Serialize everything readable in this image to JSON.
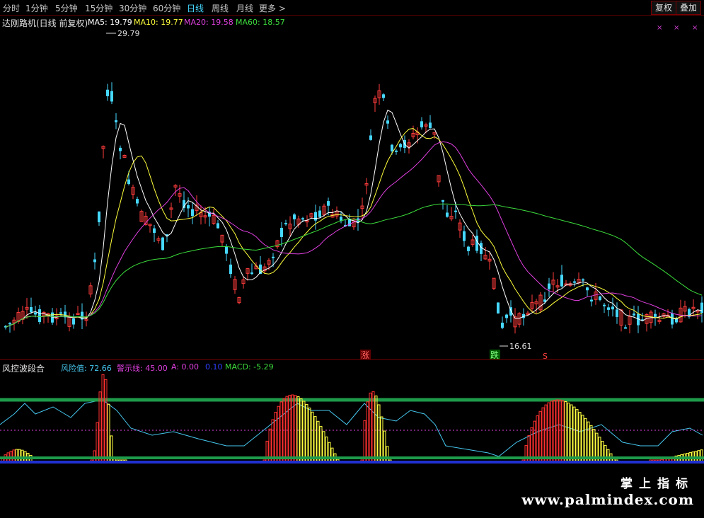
{
  "toolbar": {
    "timeframes": [
      "分时",
      "1分钟",
      "5分钟",
      "15分钟",
      "30分钟",
      "60分钟",
      "日线",
      "周线",
      "月线",
      "更多 >"
    ],
    "active": "日线",
    "buttons": [
      "复权",
      "叠加"
    ]
  },
  "main_legend": {
    "title": "达刚路机(日线 前复权)",
    "ma5": "MA5: 19.79",
    "ma10": "MA10: 19.77",
    "ma20": "MA20: 19.58",
    "ma60": "MA60: 18.57"
  },
  "sub_legend": {
    "title": "风控波段合",
    "risk": "风险值: 72.66",
    "warn": "警示线: 45.00",
    "a": "A: 0.00",
    "b": "0.10",
    "macd": "MACD: -5.29"
  },
  "annotations": {
    "high": "29.79",
    "low": "16.61",
    "up_marker": "涨",
    "down_marker": "跌",
    "s_marker": "S"
  },
  "top_right_marks": [
    "×",
    "×",
    "×"
  ],
  "watermark": {
    "cn": "掌上指标",
    "url": "www.palmindex.com"
  },
  "colors": {
    "up": "#ff3c3c",
    "down": "#46d8ff",
    "ma5": "#ffffff",
    "ma10": "#ffff3c",
    "ma20": "#e040e0",
    "ma60": "#3cdc3c",
    "risk_line": "#46c8f0",
    "warn_line": "#e040e0"
  }
}
